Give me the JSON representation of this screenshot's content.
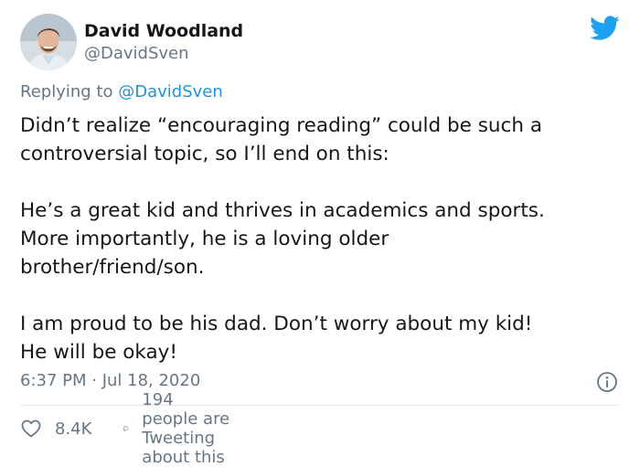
{
  "author": {
    "display_name": "David Woodland",
    "handle": "@DavidSven",
    "avatar_icon": "profile-photo"
  },
  "brand": {
    "icon": "twitter-bird-icon",
    "color": "#1da1f2"
  },
  "reply_to": {
    "prefix": "Replying to",
    "mention": "@DavidSven"
  },
  "tweet": {
    "paragraphs": [
      {
        "lines": [
          "Didn’t realize “encouraging reading” could be such a",
          "controversial topic, so I’ll end on this:"
        ]
      },
      {
        "lines": [
          "He’s a great kid and thrives in academics and sports.",
          "More importantly, he is a loving older",
          "brother/friend/son."
        ]
      },
      {
        "lines": [
          "I am proud to be his dad. Don’t worry about my kid!",
          "He will be okay!"
        ]
      }
    ],
    "timestamp": "6:37 PM · Jul 18, 2020"
  },
  "actions": {
    "like_count": "8.4K",
    "reply_text": "194 people are Tweeting about this"
  },
  "colors": {
    "text": "#14171a",
    "muted": "#657786",
    "link": "#1b95e0",
    "divider": "#e1e8ed"
  }
}
